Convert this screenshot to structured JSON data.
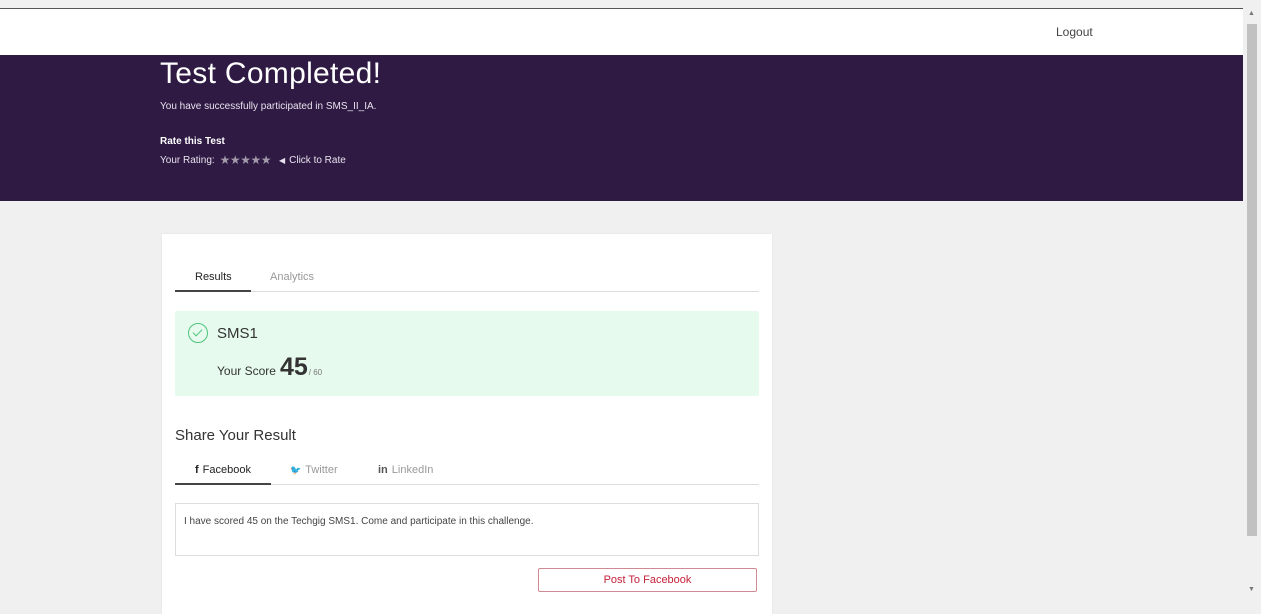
{
  "header": {
    "logout_label": "Logout"
  },
  "banner": {
    "title": "Test Completed!",
    "subtitle": "You have successfully participated in SMS_II_IA.",
    "rate_title": "Rate this Test",
    "rating_label": "Your Rating:",
    "stars": "★★★★★",
    "rating_value": 0,
    "rating_max": 5,
    "click_to_rate": "Click to Rate"
  },
  "tabs": {
    "results": "Results",
    "analytics": "Analytics"
  },
  "result": {
    "test_name": "SMS1",
    "score_label": "Your Score",
    "score": "45",
    "total": "/ 60"
  },
  "share": {
    "title": "Share Your Result",
    "tabs": [
      {
        "icon": "f",
        "label": "Facebook"
      },
      {
        "icon": "🐦",
        "label": "Twitter"
      },
      {
        "icon": "in",
        "label": "LinkedIn"
      }
    ],
    "message": "I have scored 45 on the Techgig SMS1. Come and participate in this challenge.",
    "post_button": "Post To Facebook"
  },
  "colors": {
    "banner_bg": "#2f1a43",
    "success_bg": "#e6fbee",
    "success_icon": "#4fc37d",
    "post_button_text": "#c3223a"
  }
}
